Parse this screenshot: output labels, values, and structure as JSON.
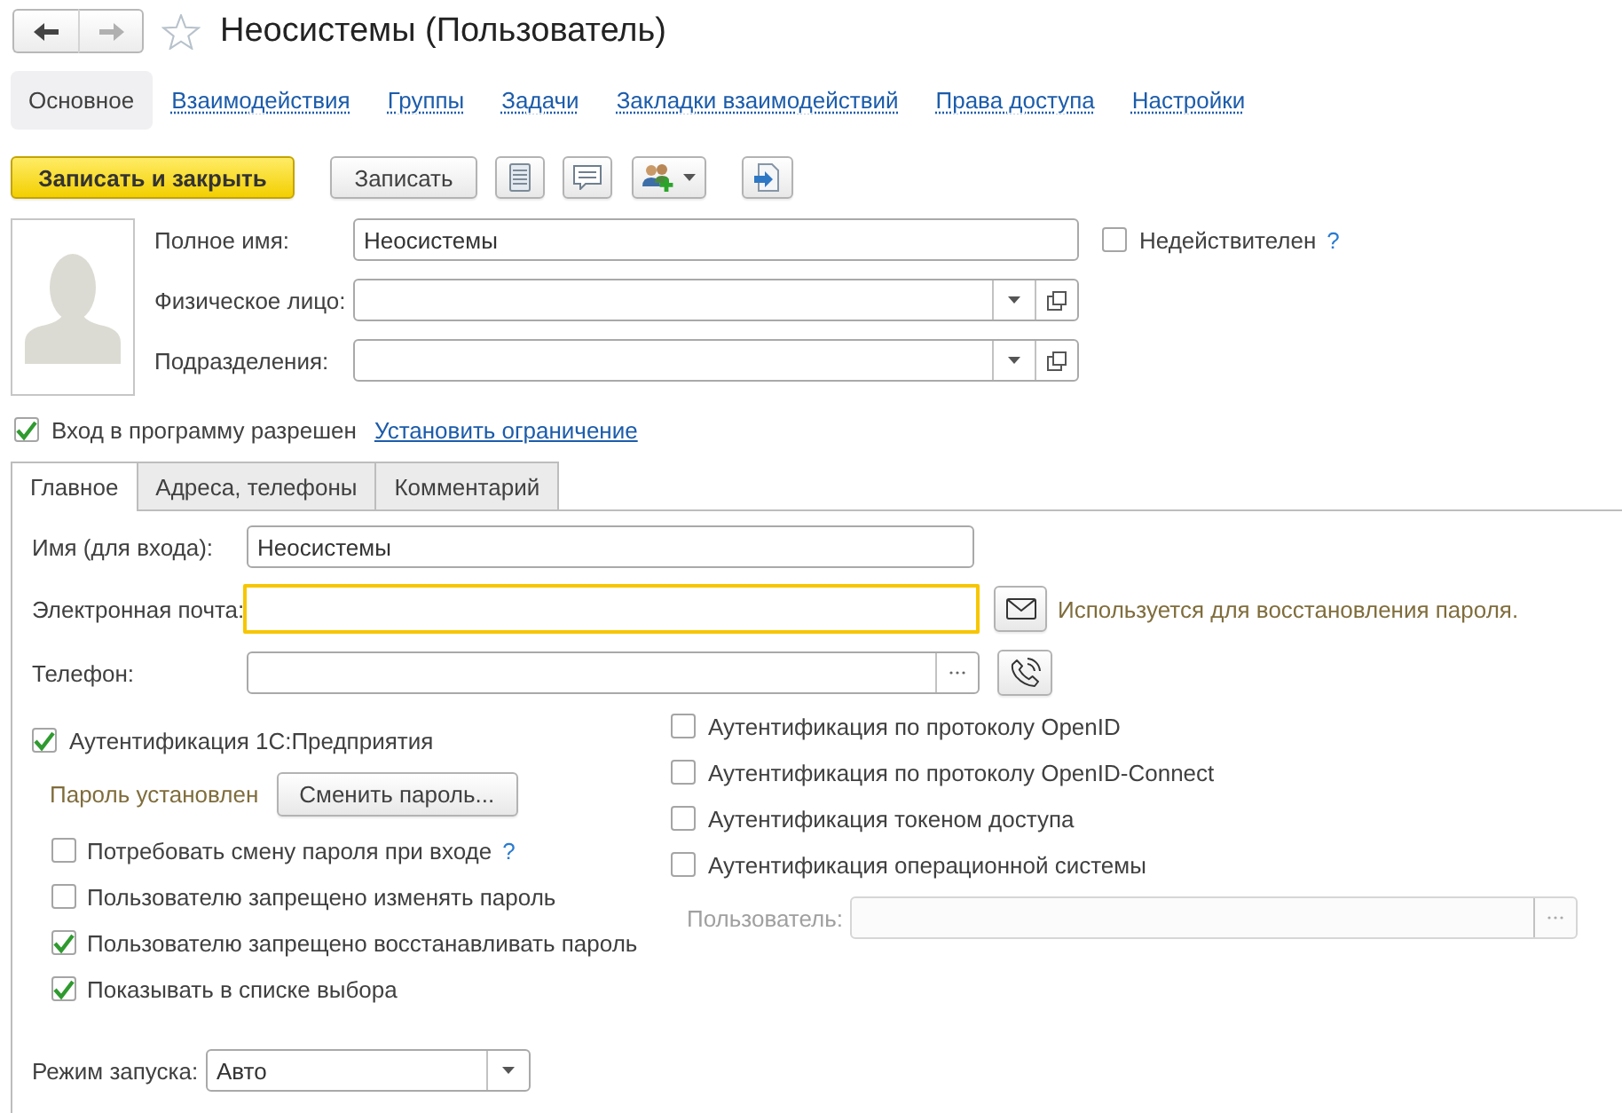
{
  "window": {
    "title": "Неосистемы (Пользователь)",
    "favorite": false
  },
  "navigation": [
    {
      "kind": "back",
      "disabled": false
    },
    {
      "kind": "forward",
      "disabled": true
    }
  ],
  "sections": [
    {
      "label": "Основное",
      "selected": true
    },
    {
      "label": "Взаимодействия",
      "selected": false
    },
    {
      "label": "Группы",
      "selected": false
    },
    {
      "label": "Задачи",
      "selected": false
    },
    {
      "label": "Закладки взаимодействий",
      "selected": false
    },
    {
      "label": "Права доступа",
      "selected": false
    },
    {
      "label": "Настройки",
      "selected": false
    }
  ],
  "toolbar": {
    "save_and_close": "Записать и закрыть",
    "save": "Записать"
  },
  "header_fields": [
    {
      "label": "Полное имя:",
      "kind": "text",
      "value": "Неосистемы"
    },
    {
      "label": "Физическое лицо:",
      "kind": "reference"
    },
    {
      "label": "Подразделения:",
      "kind": "reference"
    }
  ],
  "invalid": {
    "label": "Недействителен",
    "checked": false,
    "help": "?"
  },
  "login": {
    "label": "Вход в программу разрешен",
    "checked": true,
    "link": "Установить ограничение"
  },
  "tabs": [
    {
      "label": "Главное",
      "selected": true
    },
    {
      "label": "Адреса, телефоны",
      "selected": false
    },
    {
      "label": "Комментарий",
      "selected": false
    }
  ],
  "main_fields": [
    {
      "label": "Имя (для входа):",
      "kind": "text",
      "value": "Неосистемы",
      "focused": false
    },
    {
      "label": "Электронная почта:",
      "kind": "email",
      "focused": true,
      "hint": "Используется для восстановления пароля."
    },
    {
      "label": "Телефон:",
      "kind": "phone",
      "focused": false
    }
  ],
  "auth_1c": {
    "label": "Аутентификация 1С:Предприятия",
    "checked": true,
    "password_status": "Пароль установлен",
    "change_password": "Сменить пароль...",
    "options": [
      {
        "label": "Потребовать смену пароля при входе",
        "checked": false,
        "help": "?"
      },
      {
        "label": "Пользователю запрещено изменять пароль",
        "checked": false
      },
      {
        "label": "Пользователю запрещено восстанавливать пароль",
        "checked": true
      },
      {
        "label": "Показывать в списке выбора",
        "checked": true
      }
    ]
  },
  "other_auth": [
    {
      "label": "Аутентификация по протоколу OpenID",
      "checked": false
    },
    {
      "label": "Аутентификация по протоколу OpenID-Connect",
      "checked": false
    },
    {
      "label": "Аутентификация токеном доступа",
      "checked": false
    },
    {
      "label": "Аутентификация операционной системы",
      "checked": false
    }
  ],
  "os_user": {
    "label": "Пользователь:",
    "disabled": true
  },
  "launch_mode": {
    "label": "Режим запуска:",
    "value": "Авто"
  }
}
